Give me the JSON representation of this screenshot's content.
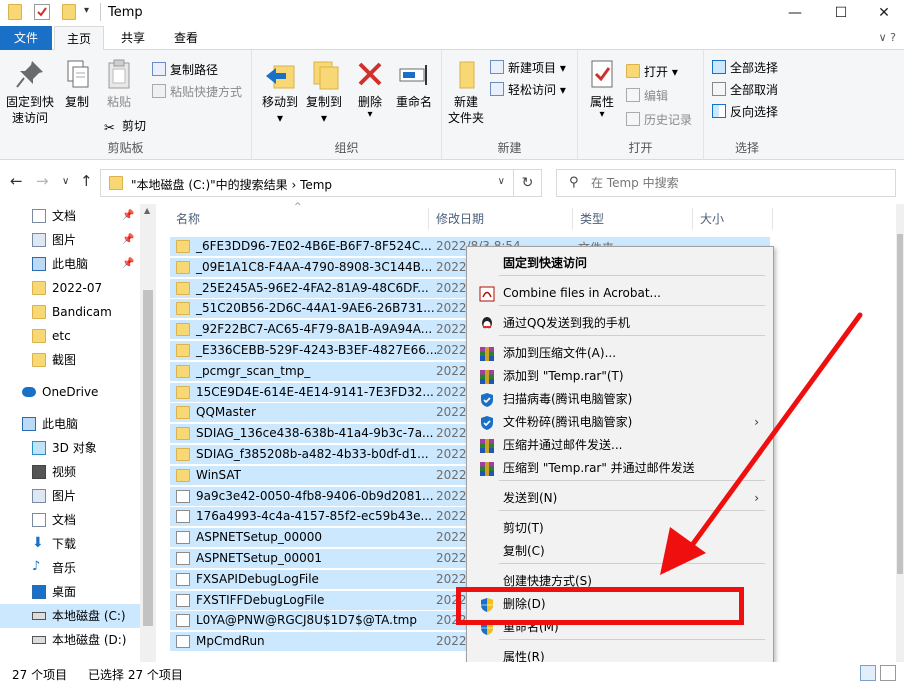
{
  "window": {
    "title": "Temp",
    "minimize": "—",
    "maximize": "☐",
    "close": "✕"
  },
  "tabs": {
    "file": "文件",
    "home": "主页",
    "share": "共享",
    "view": "查看",
    "right": "∨ ?"
  },
  "ribbon": {
    "clipboard": {
      "label": "剪贴板",
      "pin": "固定到快\n速访问",
      "copy": "复制",
      "paste": "粘贴",
      "copy_path": "复制路径",
      "paste_shortcut": "粘贴快捷方式",
      "cut": "剪切"
    },
    "organize": {
      "label": "组织",
      "move_to": "移动到",
      "copy_to": "复制到",
      "delete": "删除",
      "rename": "重命名"
    },
    "new": {
      "label": "新建",
      "new_folder": "新建\n文件夹",
      "new_item": "新建项目",
      "easy_access": "轻松访问"
    },
    "open": {
      "label": "打开",
      "properties": "属性",
      "open": "打开",
      "edit": "编辑",
      "history": "历史记录"
    },
    "select": {
      "label": "选择",
      "select_all": "全部选择",
      "select_none": "全部取消",
      "invert": "反向选择"
    }
  },
  "address": {
    "path": "\"本地磁盘 (C:)\"中的搜索结果  ›  Temp",
    "search_placeholder": "在 Temp 中搜索"
  },
  "nav": {
    "items": [
      {
        "label": "文档",
        "pinned": true
      },
      {
        "label": "图片",
        "pinned": true
      },
      {
        "label": "此电脑",
        "pinned": true
      },
      {
        "label": "2022-07"
      },
      {
        "label": "Bandicam"
      },
      {
        "label": "etc"
      },
      {
        "label": "截图"
      },
      {
        "label": "OneDrive"
      },
      {
        "label": "此电脑"
      },
      {
        "label": "3D 对象"
      },
      {
        "label": "视频"
      },
      {
        "label": "图片"
      },
      {
        "label": "文档"
      },
      {
        "label": "下载"
      },
      {
        "label": "音乐"
      },
      {
        "label": "桌面"
      },
      {
        "label": "本地磁盘 (C:)"
      },
      {
        "label": "本地磁盘 (D:)"
      }
    ],
    "pin_glyph": "📌"
  },
  "columns": {
    "name": "名称",
    "date": "修改日期",
    "type": "类型",
    "size": "大小"
  },
  "files": [
    {
      "name": "_6FE3DD96-7E02-4B6E-B6F7-8F524C...",
      "date": "2022/8/3 8:54",
      "type": "文件夹",
      "icon": "folder"
    },
    {
      "name": "_09E1A1C8-F4AA-4790-8908-3C144B...",
      "date": "2022/",
      "type": "",
      "icon": "folder"
    },
    {
      "name": "_25E245A5-96E2-4FA2-81A9-48C6DF...",
      "date": "2022/",
      "type": "",
      "icon": "folder"
    },
    {
      "name": "_51C20B56-2D6C-44A1-9AE6-26B731...",
      "date": "2022/",
      "type": "",
      "icon": "folder"
    },
    {
      "name": "_92F22BC7-AC65-4F79-8A1B-A9A94A...",
      "date": "2022/",
      "type": "",
      "icon": "folder"
    },
    {
      "name": "_E336CEBB-529F-4243-B3EF-4827E66...",
      "date": "2022/",
      "type": "",
      "icon": "folder"
    },
    {
      "name": "_pcmgr_scan_tmp_",
      "date": "2022/",
      "type": "",
      "icon": "folder"
    },
    {
      "name": "15CE9D4E-614E-4E14-9141-7E3FD32...",
      "date": "2022/",
      "type": "",
      "icon": "folder"
    },
    {
      "name": "QQMaster",
      "date": "2022/",
      "type": "",
      "icon": "folder"
    },
    {
      "name": "SDIAG_136ce438-638b-41a4-9b3c-7a...",
      "date": "2022/",
      "type": "",
      "icon": "folder"
    },
    {
      "name": "SDIAG_f385208b-a482-4b33-b0df-d1...",
      "date": "2022/",
      "type": "",
      "icon": "folder"
    },
    {
      "name": "WinSAT",
      "date": "2022/",
      "type": "",
      "icon": "folder"
    },
    {
      "name": "9a9c3e42-0050-4fb8-9406-0b9d2081...",
      "date": "2022/",
      "type": "",
      "icon": "file"
    },
    {
      "name": "176a4993-4c4a-4157-85f2-ec59b43e...",
      "date": "2022/",
      "type": "",
      "icon": "file"
    },
    {
      "name": "ASPNETSetup_00000",
      "date": "2022/",
      "type": "",
      "icon": "log"
    },
    {
      "name": "ASPNETSetup_00001",
      "date": "2022/",
      "type": "",
      "icon": "log"
    },
    {
      "name": "FXSAPIDebugLogFile",
      "date": "2022/",
      "type": "",
      "icon": "log"
    },
    {
      "name": "FXSTIFFDebugLogFile",
      "date": "2022/",
      "type": "",
      "icon": "log"
    },
    {
      "name": "L0YA@PNW@RGCJ8U$1D7$@TA.tmp",
      "date": "2022/",
      "type": "",
      "icon": "file"
    },
    {
      "name": "MpCmdRun",
      "date": "2022/",
      "type": "",
      "icon": "log"
    }
  ],
  "context_menu": {
    "items": [
      {
        "label": "固定到快速访问",
        "bold": true,
        "icon": ""
      },
      {
        "label": "Combine files in Acrobat...",
        "icon": "acrobat"
      },
      {
        "label": "通过QQ发送到我的手机",
        "icon": "qq"
      },
      {
        "label": "添加到压缩文件(A)...",
        "icon": "rar"
      },
      {
        "label": "添加到 \"Temp.rar\"(T)",
        "icon": "rar"
      },
      {
        "label": "扫描病毒(腾讯电脑管家)",
        "icon": "shield"
      },
      {
        "label": "文件粉碎(腾讯电脑管家)",
        "icon": "shield",
        "submenu": true
      },
      {
        "label": "压缩并通过邮件发送...",
        "icon": "rar"
      },
      {
        "label": "压缩到 \"Temp.rar\" 并通过邮件发送",
        "icon": "rar"
      },
      {
        "label": "发送到(N)",
        "icon": "",
        "submenu": true
      },
      {
        "label": "剪切(T)",
        "icon": ""
      },
      {
        "label": "复制(C)",
        "icon": ""
      },
      {
        "label": "创建快捷方式(S)",
        "icon": ""
      },
      {
        "label": "删除(D)",
        "icon": "uac"
      },
      {
        "label": "重命名(M)",
        "icon": "uac"
      },
      {
        "label": "属性(R)",
        "icon": ""
      }
    ],
    "arrow_glyph": "›"
  },
  "status": {
    "count": "27 个项目",
    "selected": "已选择 27 个项目"
  },
  "colors": {
    "accent": "#1a6fc7",
    "selection": "#cce8ff",
    "annotation": "#f00f0f"
  }
}
